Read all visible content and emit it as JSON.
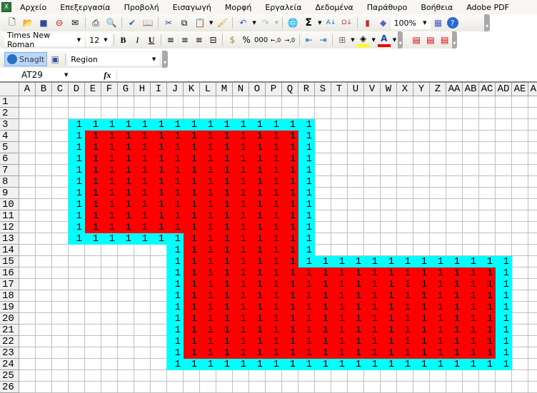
{
  "menu": [
    "Αρχείο",
    "Επεξεργασία",
    "Προβολή",
    "Εισαγωγή",
    "Μορφή",
    "Εργαλεία",
    "Δεδομένα",
    "Παράθυρο",
    "Βοήθεια",
    "Adobe PDF"
  ],
  "standard_toolbar": {
    "icons": [
      "new-icon",
      "open-icon",
      "save-icon",
      "permission-icon",
      "email-icon",
      "print-icon",
      "print-preview-icon",
      "spelling-icon",
      "research-icon",
      "cut-icon",
      "copy-icon",
      "paste-icon",
      "format-painter-icon",
      "undo-icon",
      "redo-icon",
      "hyperlink-icon",
      "autosum-icon",
      "sort-ascending-icon",
      "sort-descending-icon",
      "chart-wizard-icon",
      "drawing-icon"
    ],
    "zoom": "100%"
  },
  "formatting_toolbar": {
    "font": "Times New Roman",
    "size": "12",
    "bold": "B",
    "italic": "I",
    "underline": "U",
    "percent": "%",
    "thousands": "000"
  },
  "snagit_toolbar": {
    "label": "SnagIt",
    "mode": "Region"
  },
  "formula_bar": {
    "name_box": "AT29",
    "fx": "fx",
    "value": ""
  },
  "sheet": {
    "columns": [
      "A",
      "B",
      "C",
      "D",
      "E",
      "F",
      "G",
      "H",
      "I",
      "J",
      "K",
      "L",
      "M",
      "N",
      "O",
      "P",
      "Q",
      "R",
      "S",
      "T",
      "U",
      "V",
      "W",
      "X",
      "Y",
      "Z",
      "AA",
      "AB",
      "AC",
      "AD",
      "AE",
      "AF"
    ],
    "row_count": 26,
    "cell_value": "1",
    "value_ranges": [
      "D3:R13",
      "J14:R14",
      "J15:AD24"
    ],
    "red_ranges": [
      "E4:Q12",
      "K13:Q15",
      "K16:AC23"
    ],
    "colors": {
      "border_fill": "#00ffff",
      "interior_fill": "#ff0000",
      "gridline": "#c0c0c0"
    }
  }
}
